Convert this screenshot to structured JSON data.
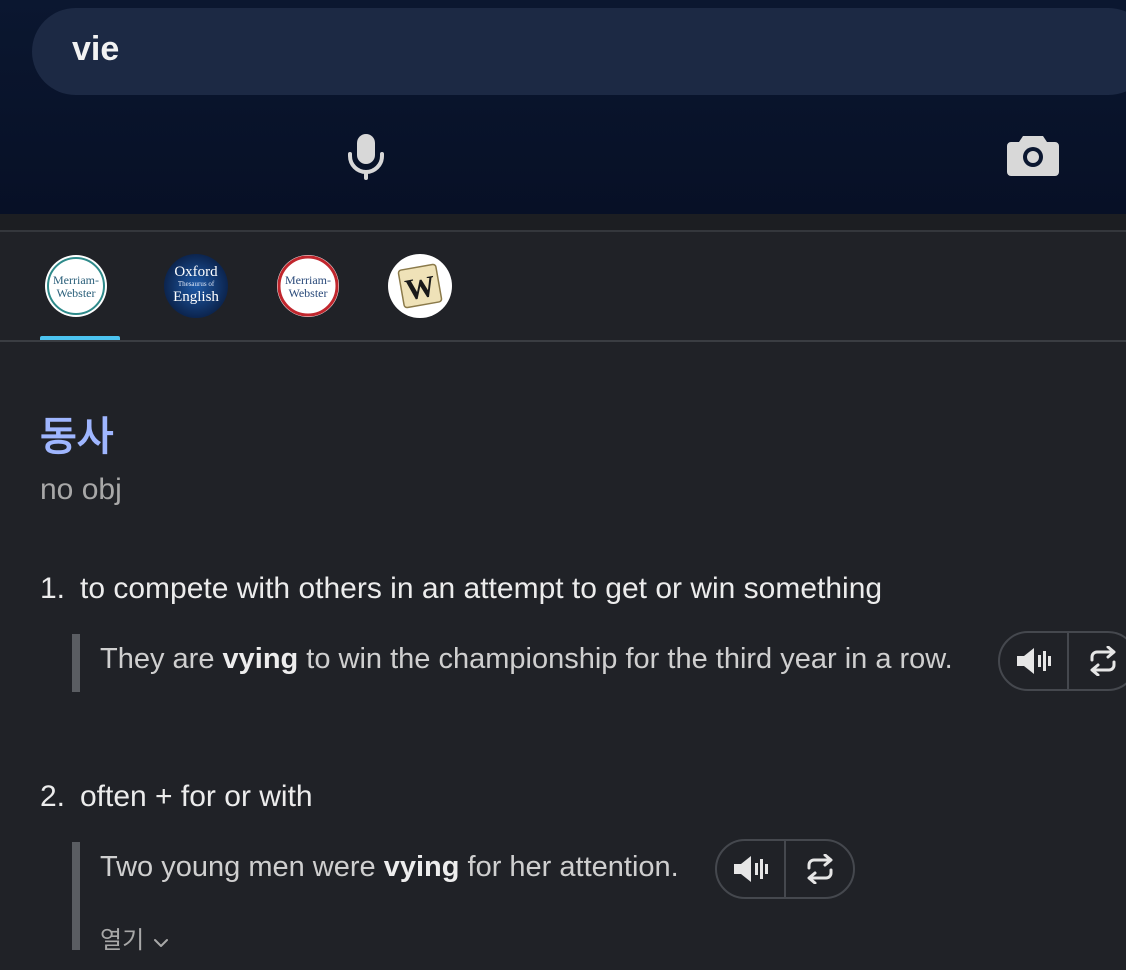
{
  "search": {
    "query": "vie"
  },
  "header": {
    "mic_icon": "microphone-icon",
    "camera_icon": "camera-icon"
  },
  "dictionaries": [
    {
      "name": "Merriam-Webster",
      "line1": "Merriam-",
      "line2": "Webster",
      "selected": true,
      "ring_color": "#2e8a8a"
    },
    {
      "name": "Oxford Thesaurus of English",
      "line1": "Oxford",
      "line2": "Thesaurus of",
      "line3": "English",
      "selected": false
    },
    {
      "name": "Merriam-Webster",
      "line1": "Merriam-",
      "line2": "Webster",
      "selected": false,
      "ring_color": "#c0262d"
    },
    {
      "name": "Wiktionary",
      "line1": "W",
      "selected": false
    }
  ],
  "entry": {
    "part_of_speech": "동사",
    "grammar": "no obj",
    "definitions": [
      {
        "number": "1.",
        "text": "to compete with others in an attempt to get or win something",
        "example_before": "They are ",
        "example_bold": "vying",
        "example_after": " to win the championship for the third year in a row."
      },
      {
        "number": "2.",
        "text": "often + for or with",
        "example_before": "Two young men were ",
        "example_bold": "vying",
        "example_after": " for her attention."
      }
    ],
    "more_label": "열기"
  },
  "colors": {
    "accent": "#4cc4f0",
    "pos": "#9fb6ff",
    "header_bg": "#0b1730"
  }
}
